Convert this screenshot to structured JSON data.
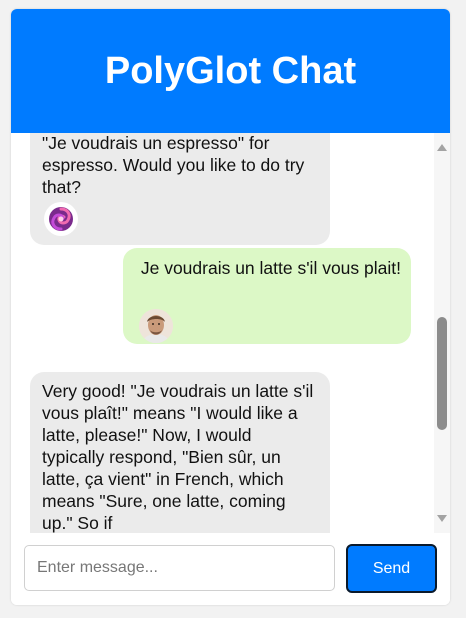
{
  "colors": {
    "header": "#007bff",
    "send_button": "#007bff",
    "bot_bubble": "#ebebeb",
    "user_bubble": "#dcf8c6"
  },
  "header": {
    "title": "PolyGlot Chat"
  },
  "messages": [
    {
      "sender": "bot",
      "avatar_icon": "swirl-logo-icon",
      "text": "\"Je voudrais un espresso\" for espresso. Would you like to do try that?"
    },
    {
      "sender": "user",
      "avatar_icon": "user-photo-avatar",
      "text": "Je voudrais un latte s'il vous plait!"
    },
    {
      "sender": "bot",
      "avatar_icon": "swirl-logo-icon",
      "text": "Very good! \"Je voudrais un latte s'il vous plaît!\" means \"I would like a latte, please!\" Now, I would typically respond, \"Bien sûr, un latte, ça vient\" in French, which means \"Sure, one latte, coming up.\" So if"
    }
  ],
  "composer": {
    "placeholder": "Enter message...",
    "value": "",
    "send_label": "Send"
  }
}
